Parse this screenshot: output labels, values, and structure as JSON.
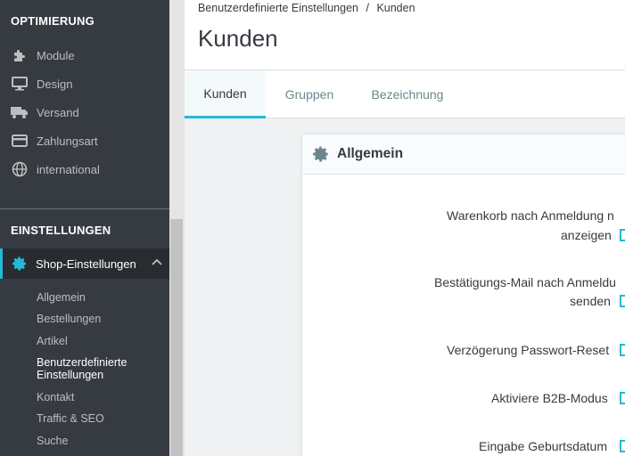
{
  "sidebar": {
    "header_optimierung": "OPTIMIERUNG",
    "items": [
      {
        "label": "Module",
        "icon": "puzzle-icon"
      },
      {
        "label": "Design",
        "icon": "monitor-icon"
      },
      {
        "label": "Versand",
        "icon": "truck-icon"
      },
      {
        "label": "Zahlungsart",
        "icon": "credit-card-icon"
      },
      {
        "label": "international",
        "icon": "globe-icon"
      }
    ],
    "header_einstellungen": "EINSTELLUNGEN",
    "active_item": {
      "label": "Shop-Einstellungen",
      "icon": "gear-icon"
    },
    "subitems": [
      {
        "label": "Allgemein"
      },
      {
        "label": "Bestellungen"
      },
      {
        "label": "Artikel"
      },
      {
        "label": "Benutzerdefinierte Einstellungen",
        "current": true
      },
      {
        "label": "Kontakt"
      },
      {
        "label": "Traffic & SEO"
      },
      {
        "label": "Suche"
      }
    ]
  },
  "header": {
    "breadcrumb_parent": "Benutzerdefinierte Einstellungen",
    "breadcrumb_sep": "/",
    "breadcrumb_current": "Kunden",
    "title": "Kunden"
  },
  "tabs": [
    {
      "label": "Kunden",
      "active": true
    },
    {
      "label": "Gruppen"
    },
    {
      "label": "Bezeichnung"
    }
  ],
  "card": {
    "title": "Allgemein",
    "fields": [
      {
        "line1": "Warenkorb nach Anmeldung n",
        "line2": "anzeigen"
      },
      {
        "line1": "Bestätigungs-Mail nach Anmeldu",
        "line2": "senden"
      },
      {
        "line1": "Verzögerung Passwort-Reset"
      },
      {
        "line1": "Aktiviere B2B-Modus"
      },
      {
        "line1": "Eingabe Geburtsdatum"
      }
    ]
  },
  "colors": {
    "accent": "#25b9d7",
    "sidebar_bg": "#363a41",
    "sidebar_active_bg": "#282b30"
  }
}
